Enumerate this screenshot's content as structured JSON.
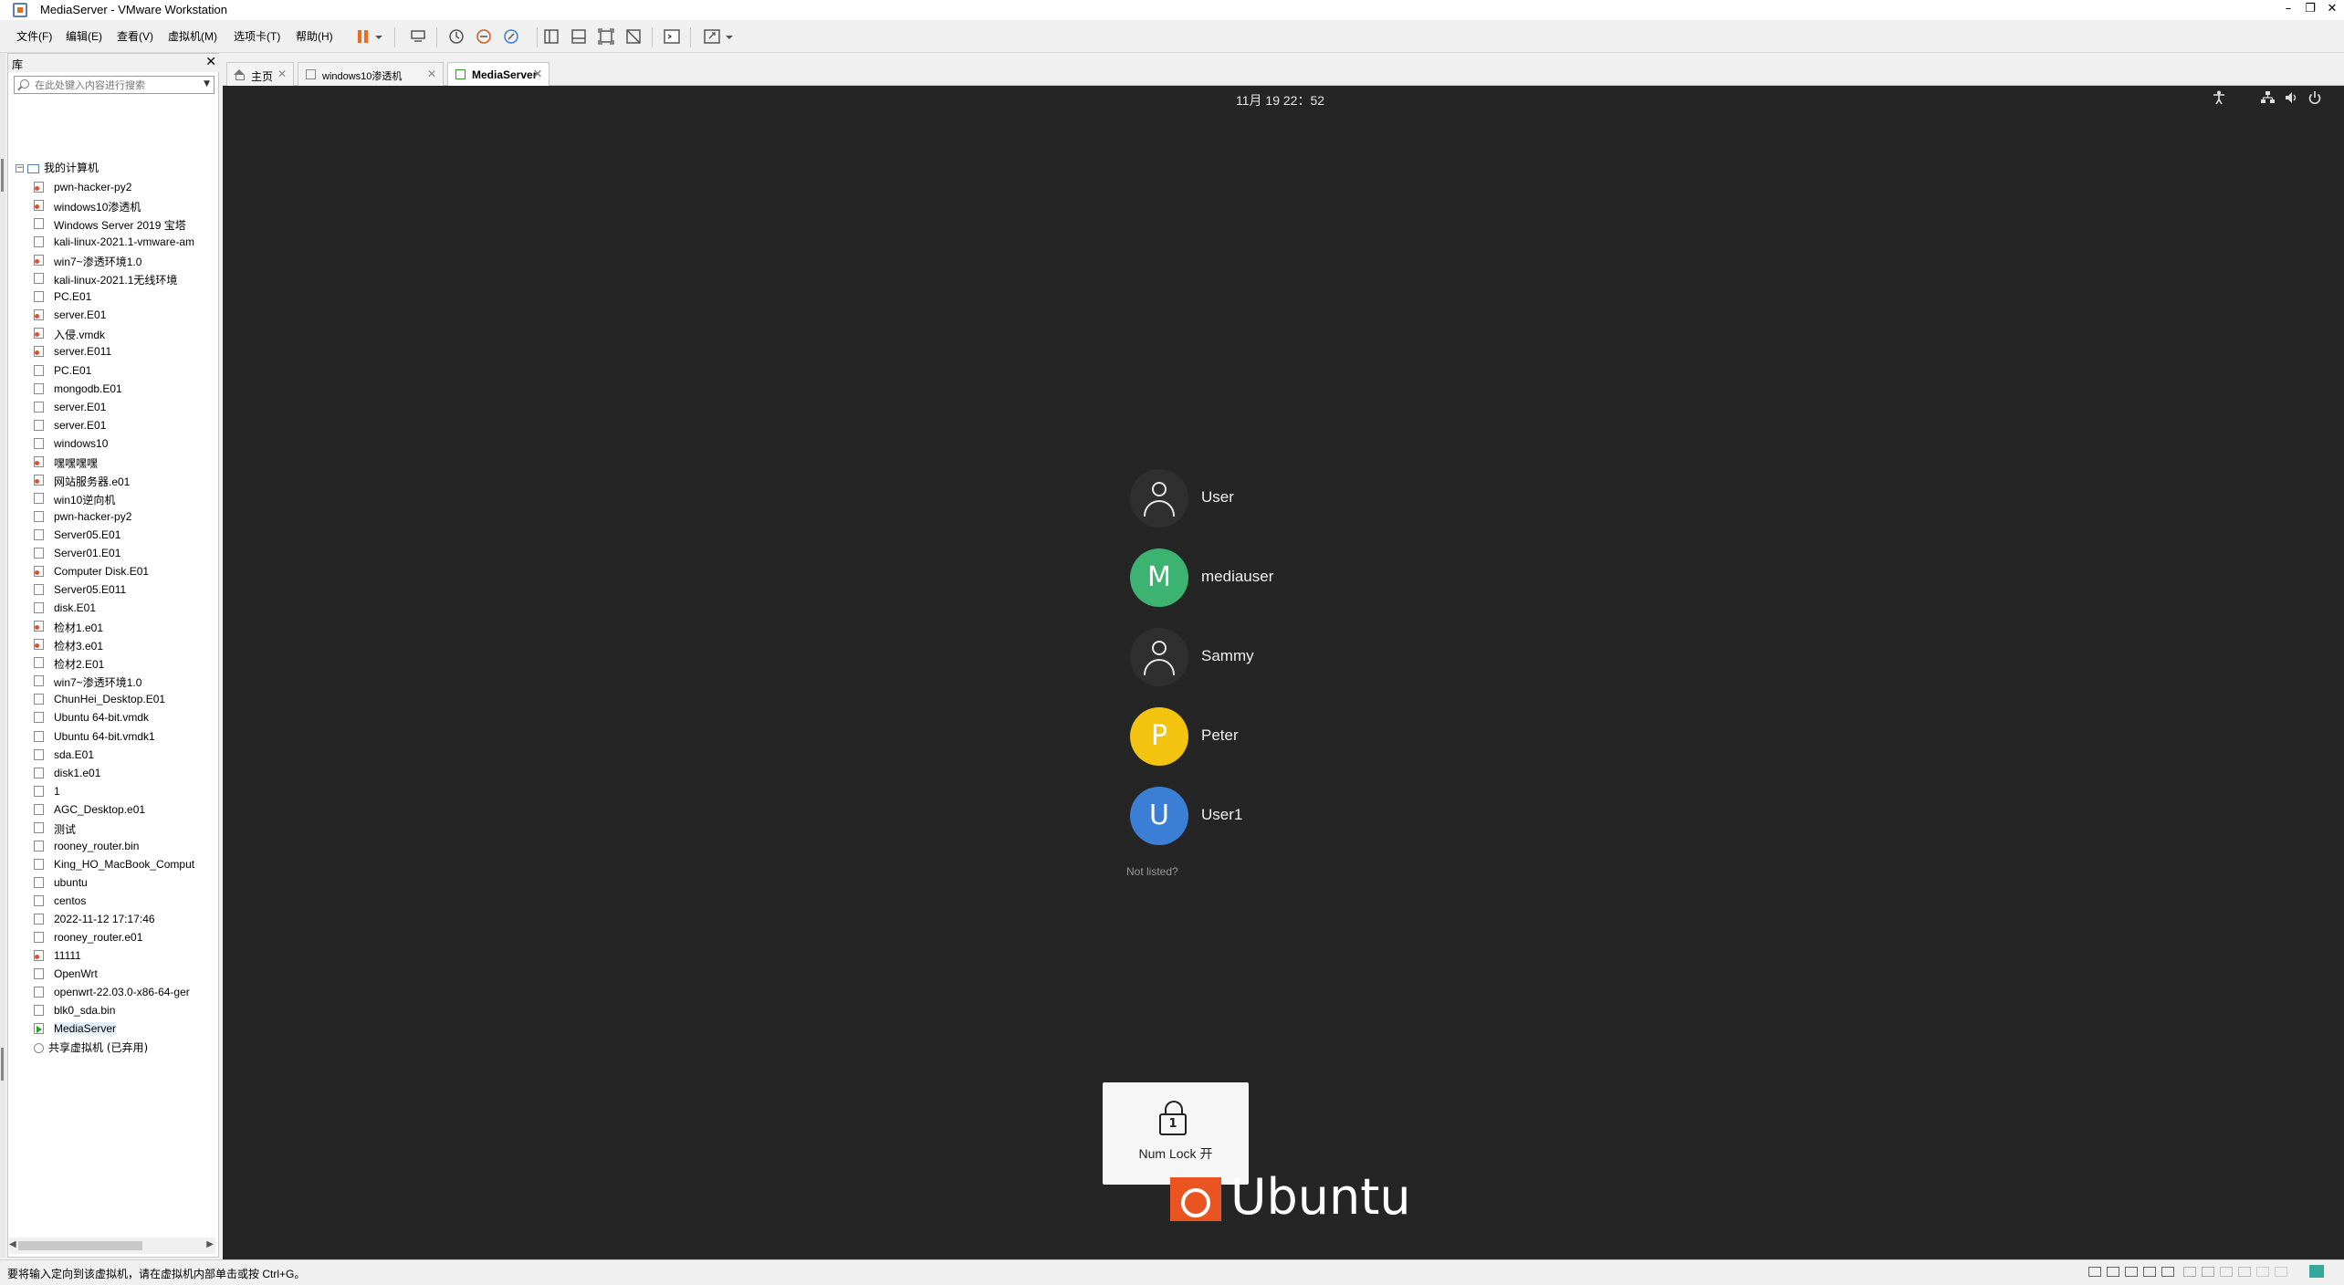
{
  "window": {
    "title": "MediaServer - VMware Workstation",
    "minimize": "–",
    "maximize": "❐",
    "close": "✕"
  },
  "menu": [
    "文件(F)",
    "编辑(E)",
    "查看(V)",
    "虚拟机(M)",
    "选项卡(T)",
    "帮助(H)"
  ],
  "library": {
    "title": "库",
    "close": "✕",
    "search_placeholder": "在此处键入内容进行搜索",
    "root_label": "我的计算机",
    "shared_label": "共享虚拟机 (已弃用)",
    "items": [
      {
        "label": "pwn-hacker-py2",
        "state": "locked"
      },
      {
        "label": "windows10渗透机",
        "state": "locked"
      },
      {
        "label": "Windows Server 2019 宝塔",
        "state": "normal"
      },
      {
        "label": "kali-linux-2021.1-vmware-am",
        "state": "normal"
      },
      {
        "label": "win7~渗透环境1.0",
        "state": "locked"
      },
      {
        "label": "kali-linux-2021.1无线环境",
        "state": "normal"
      },
      {
        "label": "PC.E01",
        "state": "normal"
      },
      {
        "label": "server.E01",
        "state": "locked"
      },
      {
        "label": "入侵.vmdk",
        "state": "locked"
      },
      {
        "label": "server.E011",
        "state": "locked"
      },
      {
        "label": "PC.E01",
        "state": "normal"
      },
      {
        "label": "mongodb.E01",
        "state": "normal"
      },
      {
        "label": "server.E01",
        "state": "normal"
      },
      {
        "label": "server.E01",
        "state": "normal"
      },
      {
        "label": "windows10",
        "state": "normal"
      },
      {
        "label": "嘿嘿嘿嘿",
        "state": "locked"
      },
      {
        "label": "网站服务器.e01",
        "state": "locked"
      },
      {
        "label": "win10逆向机",
        "state": "normal"
      },
      {
        "label": "pwn-hacker-py2",
        "state": "normal"
      },
      {
        "label": "Server05.E01",
        "state": "normal"
      },
      {
        "label": "Server01.E01",
        "state": "normal"
      },
      {
        "label": "Computer Disk.E01",
        "state": "locked"
      },
      {
        "label": "Server05.E011",
        "state": "normal"
      },
      {
        "label": "disk.E01",
        "state": "normal"
      },
      {
        "label": "检材1.e01",
        "state": "locked"
      },
      {
        "label": "检材3.e01",
        "state": "locked"
      },
      {
        "label": "检材2.E01",
        "state": "normal"
      },
      {
        "label": "win7~渗透环境1.0",
        "state": "normal"
      },
      {
        "label": "ChunHei_Desktop.E01",
        "state": "normal"
      },
      {
        "label": "Ubuntu 64-bit.vmdk",
        "state": "normal"
      },
      {
        "label": "Ubuntu 64-bit.vmdk1",
        "state": "normal"
      },
      {
        "label": "sda.E01",
        "state": "normal"
      },
      {
        "label": "disk1.e01",
        "state": "normal"
      },
      {
        "label": "1",
        "state": "normal"
      },
      {
        "label": "AGC_Desktop.e01",
        "state": "normal"
      },
      {
        "label": "测试",
        "state": "normal"
      },
      {
        "label": "rooney_router.bin",
        "state": "normal"
      },
      {
        "label": "King_HO_MacBook_Comput",
        "state": "normal"
      },
      {
        "label": "ubuntu",
        "state": "normal"
      },
      {
        "label": "centos",
        "state": "normal"
      },
      {
        "label": "2022-11-12 17:17:46",
        "state": "normal"
      },
      {
        "label": "rooney_router.e01",
        "state": "normal"
      },
      {
        "label": "11111",
        "state": "locked"
      },
      {
        "label": "OpenWrt",
        "state": "normal"
      },
      {
        "label": "openwrt-22.03.0-x86-64-ger",
        "state": "normal"
      },
      {
        "label": "blk0_sda.bin",
        "state": "normal"
      },
      {
        "label": "MediaServer",
        "state": "running"
      }
    ]
  },
  "tabs": [
    {
      "label": "主页",
      "active": false
    },
    {
      "label": "windows10渗透机",
      "active": false
    },
    {
      "label": "MediaServer",
      "active": true
    }
  ],
  "vm": {
    "clock": "11月 19  22：52",
    "users": [
      {
        "name": "User",
        "initial": "",
        "avatar": "generic",
        "color": "#2f2f2f"
      },
      {
        "name": "mediauser",
        "initial": "M",
        "avatar": "letter",
        "color": "#3cb371"
      },
      {
        "name": "Sammy",
        "initial": "",
        "avatar": "generic",
        "color": "#2f2f2f"
      },
      {
        "name": "Peter",
        "initial": "P",
        "avatar": "letter",
        "color": "#f2c40f"
      },
      {
        "name": "User1",
        "initial": "U",
        "avatar": "letter",
        "color": "#3a7fd5"
      }
    ],
    "not_listed": "Not listed?",
    "osd": {
      "label": "Num Lock 开",
      "digit": "1"
    },
    "logo_text": "Ubuntu"
  },
  "status": {
    "text": "要将输入定向到该虚拟机，请在虚拟机内部单击或按 Ctrl+G。"
  },
  "colors": {
    "vm_background": "#252525",
    "ubuntu_orange": "#e95420"
  }
}
